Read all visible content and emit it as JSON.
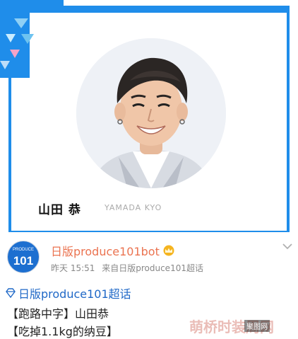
{
  "card": {
    "name": "山田 恭",
    "romaji": "YAMADA KYO"
  },
  "post": {
    "avatar_small": "PRODUCE",
    "avatar_big": "101",
    "username": "日版produce101bot",
    "time": "昨天 15:51",
    "source": "来自日版produce101超话",
    "topic": "日版produce101超话",
    "lines": [
      "【跑路中字】山田恭",
      "【吃掉1.1kg的纳豆】"
    ]
  },
  "watermark": {
    "text": "萌桥时装周网",
    "badge": "聚图网"
  },
  "colors": {
    "frame_blue": "#1f8dea",
    "username": "#eb7350",
    "topic": "#1f68c7"
  }
}
